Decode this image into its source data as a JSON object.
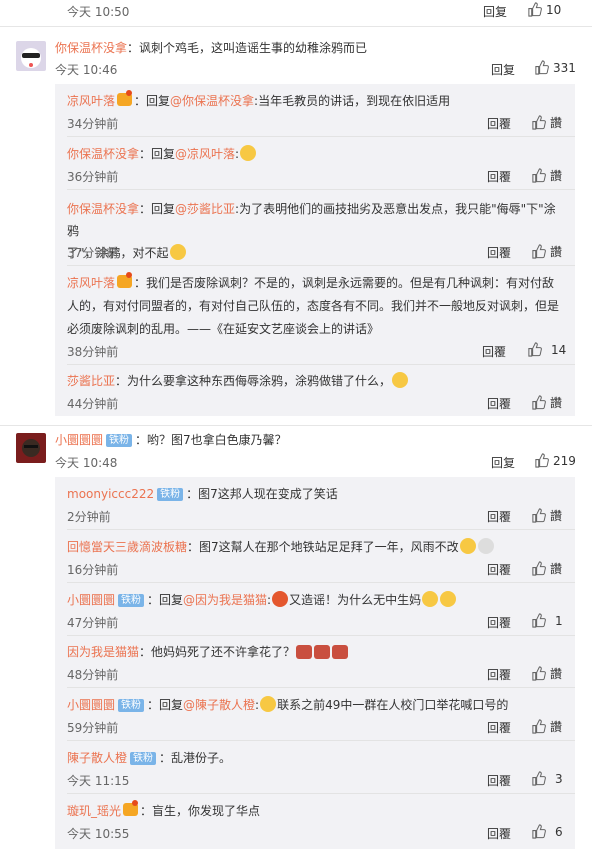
{
  "top": {
    "time": "今天 10:50",
    "reply": "回复",
    "likes": "10"
  },
  "c1": {
    "user": "你保温杯没拿",
    "text": "：讽刺个鸡毛，这叫造谣生事的幼稚涂鸦而已",
    "time": "今天 10:46",
    "reply": "回复",
    "likes": "331",
    "subs": [
      {
        "user": "凉风叶落",
        "pre": "：回复",
        "at": "@你保温杯没拿",
        "text": ":当年毛教员的讲话，到现在依旧适用",
        "time": "34分钟前",
        "reply": "回覆",
        "likes": "讚"
      },
      {
        "user": "你保温杯没拿",
        "pre": "：回复",
        "at": "@凉风叶落",
        "text": ":",
        "time": "36分钟前",
        "reply": "回覆",
        "likes": "讚"
      },
      {
        "user": "你保温杯没拿",
        "pre": "：回复",
        "at": "@莎酱比亚",
        "text": ":为了表明他们的画技拙劣及恶意出发点，我只能\"侮辱\"下\"涂鸦",
        "text2": "了\"，涂鸦，对不起",
        "time": "37分钟前",
        "reply": "回覆",
        "likes": "讚"
      },
      {
        "user": "凉风叶落",
        "text": "：我们是否废除讽刺？不是的，讽刺是永远需要的。但是有几种讽刺：有对付敌",
        "text2": "人的，有对付同盟者的，有对付自己队伍的，态度各有不同。我们并不一般地反对讽刺，但是",
        "text3": "必须废除讽刺的乱用。——《在延安文艺座谈会上的讲话》",
        "time": "38分钟前",
        "reply": "回覆",
        "likes": "14"
      },
      {
        "user": "莎酱比亚",
        "text": "：为什么要拿这种东西侮辱涂鸦，涂鸦做错了什么，",
        "time": "44分钟前",
        "reply": "回覆",
        "likes": "讚"
      }
    ]
  },
  "c2": {
    "user": "小圜圜圜",
    "badge": "铁粉",
    "text": "：哟？图7也拿白色康乃馨？",
    "time": "今天 10:48",
    "reply": "回复",
    "likes": "219",
    "subs": [
      {
        "user": "moonyiccc222",
        "badge": "铁粉",
        "text": "：图7这邦人现在变成了笑话",
        "time": "2分钟前",
        "reply": "回覆",
        "likes": "讚"
      },
      {
        "user": "回憶當天三歲滴波板糖",
        "text": "：图7这幫人在那个地铁站足足拜了一年，风雨不改",
        "time": "16分钟前",
        "reply": "回覆",
        "likes": "讚"
      },
      {
        "user": "小圜圜圜",
        "badge": "铁粉",
        "pre": "：回复",
        "at": "@因为我是猫猫",
        "text": ":",
        "text_b": "又造谣！为什么无中生妈",
        "time": "47分钟前",
        "reply": "回覆",
        "likes": "1"
      },
      {
        "user": "因为我是猫猫",
        "text": "：他妈妈死了还不许拿花了？",
        "time": "48分钟前",
        "reply": "回覆",
        "likes": "讚"
      },
      {
        "user": "小圜圜圜",
        "badge": "铁粉",
        "pre": "：回复",
        "at": "@陳子散人橙",
        "text": ":",
        "text_b": "联系之前49中一群在人校门口举花喊口号的",
        "time": "59分钟前",
        "reply": "回覆",
        "likes": "讚"
      },
      {
        "user": "陳子散人橙",
        "badge": "铁粉",
        "text": "：乱港份子。",
        "time": "今天 11:15",
        "reply": "回覆",
        "likes": "3"
      },
      {
        "user": "璇玑_瑶光",
        "text": "：盲生，你发现了华点",
        "time": "今天 10:55",
        "reply": "回覆",
        "likes": "6"
      }
    ]
  }
}
